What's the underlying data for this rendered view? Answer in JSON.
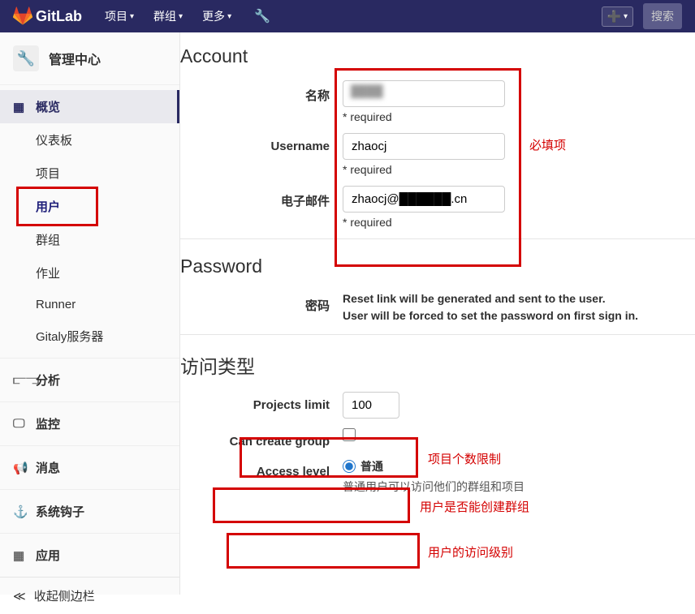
{
  "topbar": {
    "brand": "GitLab",
    "nav": [
      {
        "label": "项目"
      },
      {
        "label": "群组"
      },
      {
        "label": "更多"
      }
    ],
    "search_placeholder": "搜索"
  },
  "sidebar": {
    "title": "管理中心",
    "overview": {
      "label": "概览"
    },
    "overview_items": [
      {
        "label": "仪表板"
      },
      {
        "label": "项目"
      },
      {
        "label": "用户",
        "selected": true
      },
      {
        "label": "群组"
      },
      {
        "label": "作业"
      },
      {
        "label": "Runner"
      },
      {
        "label": "Gitaly服务器"
      }
    ],
    "sections": [
      {
        "icon": "chart",
        "label": "分析"
      },
      {
        "icon": "monitor",
        "label": "监控"
      },
      {
        "icon": "horn",
        "label": "消息"
      },
      {
        "icon": "anchor",
        "label": "系统钩子"
      },
      {
        "icon": "apps",
        "label": "应用"
      }
    ],
    "collapse": "收起侧边栏"
  },
  "main": {
    "account": {
      "title": "Account",
      "name": {
        "label": "名称",
        "value": "",
        "required": "* required"
      },
      "username": {
        "label": "Username",
        "value": "zhaocj",
        "required": "* required"
      },
      "email": {
        "label": "电子邮件",
        "value": "zhaocj@██████.cn",
        "required": "* required"
      }
    },
    "password": {
      "title": "Password",
      "label": "密码",
      "help1": "Reset link will be generated and sent to the user.",
      "help2": "User will be forced to set the password on first sign in."
    },
    "access": {
      "title": "访问类型",
      "projects_limit": {
        "label": "Projects limit",
        "value": "100"
      },
      "can_create_group": {
        "label": "Can create group"
      },
      "access_level": {
        "label": "Access level",
        "option": "普通",
        "help": "普通用户可以访问他们的群组和项目"
      }
    }
  },
  "annotations": {
    "required_fields": "必填项",
    "projects_limit": "项目个数限制",
    "can_create_group": "用户是否能创建群组",
    "access_level": "用户的访问级别"
  }
}
